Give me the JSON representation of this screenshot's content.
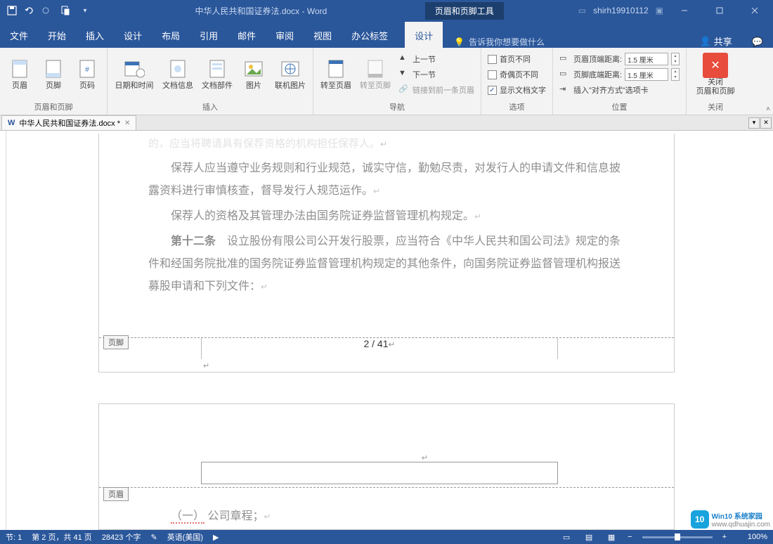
{
  "title_bar": {
    "doc_title": "中华人民共和国证券法.docx  -  Word",
    "contextual_tab": "页眉和页脚工具",
    "account": "shirh19910112"
  },
  "tabs": {
    "file": "文件",
    "home": "开始",
    "insert": "插入",
    "design": "设计",
    "layout": "布局",
    "references": "引用",
    "mailings": "邮件",
    "review": "审阅",
    "view": "视图",
    "officetab": "办公标签",
    "hf_design": "设计",
    "tell_me": "告诉我你想要做什么",
    "share": "共享"
  },
  "ribbon": {
    "group_hf": "页眉和页脚",
    "header": "页眉",
    "footer": "页脚",
    "page_num": "页码",
    "group_insert": "插入",
    "datetime": "日期和时间",
    "docinfo": "文档信息",
    "docparts": "文档部件",
    "pictures": "图片",
    "online_pic": "联机图片",
    "group_nav": "导航",
    "goto_header": "转至页眉",
    "goto_footer": "转至页脚",
    "prev_section": "上一节",
    "next_section": "下一节",
    "link_prev": "链接到前一条页眉",
    "group_options": "选项",
    "diff_first": "首页不同",
    "diff_odd_even": "奇偶页不同",
    "show_doc_text": "显示文档文字",
    "group_position": "位置",
    "header_top": "页眉顶端距离:",
    "footer_bottom": "页脚底端距离:",
    "insert_align": "插入\"对齐方式\"选项卡",
    "dist_value": "1.5 厘米",
    "group_close": "关闭",
    "close_hf_1": "关闭",
    "close_hf_2": "页眉和页脚"
  },
  "doc_tab": {
    "name": "中华人民共和国证券法.docx *"
  },
  "document": {
    "line0_tail": "的，应当将聘请具有保荐资格的机构担任保荐人。",
    "p1": "保荐人应当遵守业务规则和行业规范，诚实守信，勤勉尽责，对发行人的申请文件和信息披露资料进行审慎核查，督导发行人规范运作。",
    "p2": "保荐人的资格及其管理办法由国务院证券监督管理机构规定。",
    "art12": "第十二条",
    "p3": "　设立股份有限公司公开发行股票，应当符合《中华人民共和国公司法》规定的条件和经国务院批准的国务院证券监督管理机构规定的其他条件，向国务院证券监督管理机构报送募股申请和下列文件：",
    "footer_tag": "页脚",
    "header_tag": "页眉",
    "page_number": "2 / 41",
    "item1": "（一）公司章程；"
  },
  "status": {
    "section": "节: 1",
    "page": "第 2 页，共 41 页",
    "words": "28423 个字",
    "lang": "英语(美国)",
    "zoom": "100%"
  },
  "watermark": {
    "brand": "Win10 系统家园",
    "url": "www.qdhuajin.com"
  }
}
